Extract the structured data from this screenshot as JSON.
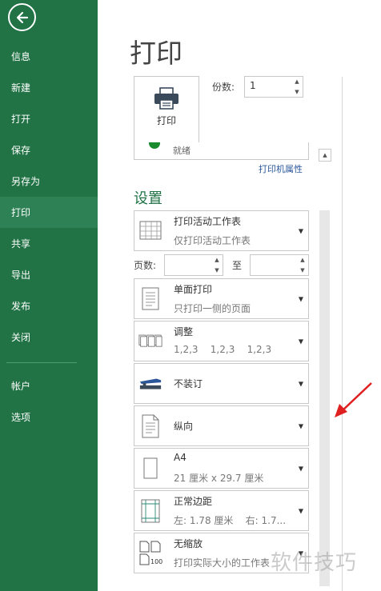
{
  "sidebar": {
    "items": [
      {
        "label": "信息"
      },
      {
        "label": "新建"
      },
      {
        "label": "打开"
      },
      {
        "label": "保存"
      },
      {
        "label": "另存为"
      },
      {
        "label": "打印"
      },
      {
        "label": "共享"
      },
      {
        "label": "导出"
      },
      {
        "label": "发布"
      },
      {
        "label": "关闭"
      },
      {
        "label": "帐户"
      },
      {
        "label": "选项"
      }
    ]
  },
  "page_title": "打印",
  "print_button_label": "打印",
  "copies": {
    "label": "份数:",
    "value": "1"
  },
  "printer": {
    "status": "就绪",
    "properties_link": "打印机属性"
  },
  "settings": {
    "title": "设置",
    "print_what": {
      "title": "打印活动工作表",
      "subtitle": "仅打印活动工作表"
    },
    "pages": {
      "label": "页数:",
      "to_label": "至",
      "from_value": "",
      "to_value": ""
    },
    "sides": {
      "title": "单面打印",
      "subtitle": "只打印一侧的页面"
    },
    "collate": {
      "title": "调整",
      "subtitle": "1,2,3    1,2,3    1,2,3"
    },
    "binding": {
      "title": "不装订"
    },
    "orientation": {
      "title": "纵向"
    },
    "paper": {
      "title": "A4",
      "subtitle": "21 厘米 x 29.7 厘米"
    },
    "margins": {
      "title": "正常边距",
      "subtitle": "左: 1.78 厘米    右: 1.7..."
    },
    "scaling": {
      "title": "无缩放",
      "subtitle": "打印实际大小的工作表"
    }
  },
  "watermark": "软件技巧",
  "colors": {
    "sidebar": "#217346",
    "accent": "#217346",
    "link": "#2b579a",
    "annotation_arrow": "#e02020"
  }
}
